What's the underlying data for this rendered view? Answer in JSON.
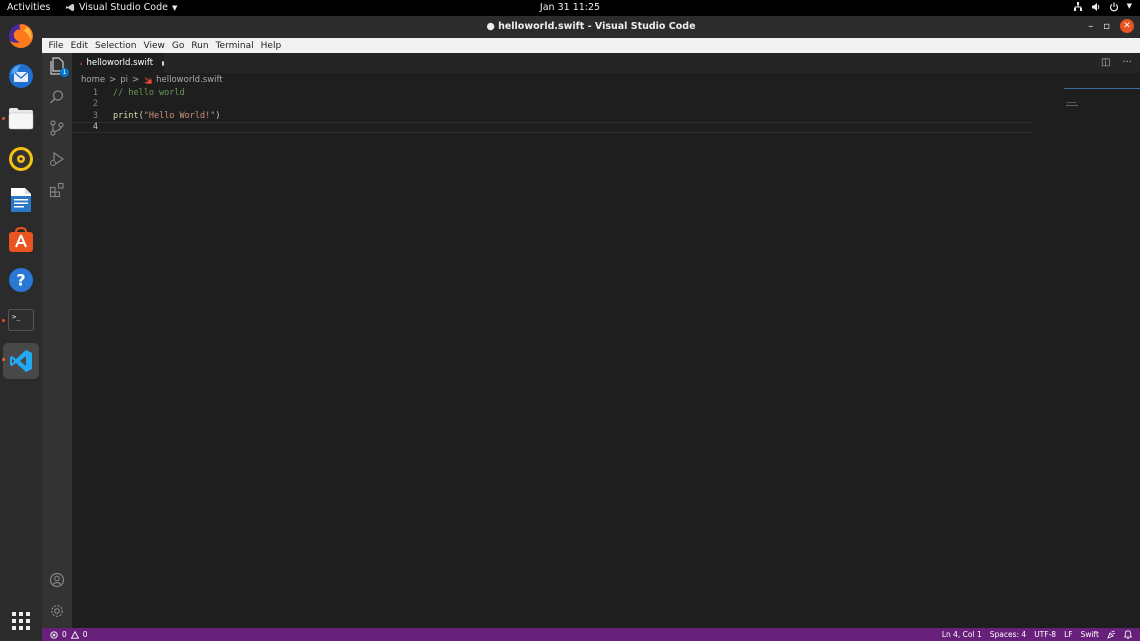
{
  "topbar": {
    "activities": "Activities",
    "app_name": "Visual Studio Code",
    "clock": "Jan 31  11:25"
  },
  "dock": {
    "apps": [
      {
        "name": "firefox-icon",
        "icon": "firefox"
      },
      {
        "name": "thunderbird-icon",
        "icon": "thunderbird"
      },
      {
        "name": "files-icon",
        "icon": "files"
      },
      {
        "name": "rhythmbox-icon",
        "icon": "rhythmbox"
      },
      {
        "name": "libreoffice-writer-icon",
        "icon": "writer"
      },
      {
        "name": "software-center-icon",
        "icon": "software"
      },
      {
        "name": "help-icon",
        "icon": "help"
      },
      {
        "name": "terminal-icon",
        "icon": "terminal"
      },
      {
        "name": "vscode-icon",
        "icon": "vscode"
      }
    ],
    "help_glyph": "?",
    "terminal_glyph": ">_"
  },
  "window": {
    "title": "● helloworld.swift - Visual Studio Code",
    "minimize": "–",
    "maximize": "▫",
    "close": "✕"
  },
  "menu": [
    "File",
    "Edit",
    "Selection",
    "View",
    "Go",
    "Run",
    "Terminal",
    "Help"
  ],
  "activity": {
    "explorer_badge": "1"
  },
  "tab": {
    "filename": "helloworld.swift"
  },
  "tab_actions": {
    "split": "◫",
    "more": "···"
  },
  "breadcrumbs": {
    "seg1": "home",
    "seg2": "pi",
    "seg3": "helloworld.swift",
    "separator": ">"
  },
  "editor": {
    "lines": [
      {
        "n": "1",
        "comment": "// hello world"
      },
      {
        "n": "2"
      },
      {
        "n": "3",
        "func": "print",
        "open": "(",
        "string": "\"Hello World!\"",
        "close": ")"
      },
      {
        "n": "4"
      }
    ]
  },
  "status": {
    "errors": "0",
    "warnings": "0",
    "position": "Ln 4, Col 1",
    "spaces": "Spaces: 4",
    "encoding": "UTF-8",
    "eol": "LF",
    "language": "Swift"
  },
  "colors": {
    "statusbar": "#68217a",
    "accent": "#e95420",
    "vscode_blue": "#0078d4"
  }
}
